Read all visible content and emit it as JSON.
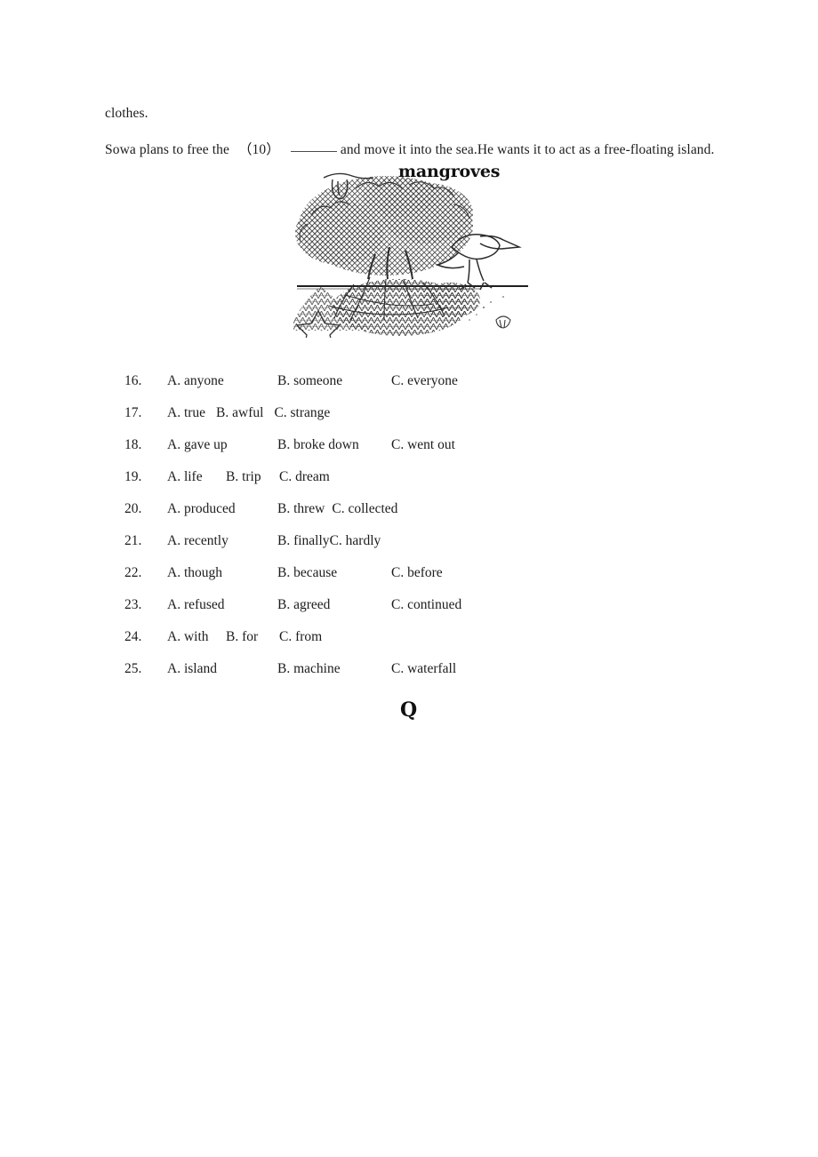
{
  "passage": {
    "line1": "clothes.",
    "line2_before": "Sowa plans to free the",
    "line2_paren": "（10）",
    "line2_after": "and move it into the sea.He wants it to act as a free-floating island."
  },
  "figure": {
    "caption": "mangroves",
    "alt_name": "mangroves-illustration"
  },
  "options": [
    {
      "number": "16.",
      "layout": "wide",
      "a": "A. anyone",
      "b": "B. someone",
      "c": "C. everyone"
    },
    {
      "number": "17.",
      "layout": "inline",
      "a": "A. true",
      "b": "B. awful",
      "c": "C. strange"
    },
    {
      "number": "18.",
      "layout": "wide",
      "a": "A. gave up",
      "b": "B. broke down",
      "c": "C. went out"
    },
    {
      "number": "19.",
      "layout": "abfix",
      "a": "A. life",
      "b": "B. trip",
      "c": "C. dream"
    },
    {
      "number": "20.",
      "layout": "mixed",
      "a": "A. produced",
      "b": "B. threw",
      "c": "C. collected"
    },
    {
      "number": "21.",
      "layout": "tight",
      "a": "A. recently",
      "b": "B. finally",
      "c": "C. hardly"
    },
    {
      "number": "22.",
      "layout": "wide",
      "a": "A. though",
      "b": "B. because",
      "c": "C. before"
    },
    {
      "number": "23.",
      "layout": "wide",
      "a": "A. refused",
      "b": "B. agreed",
      "c": "C. continued"
    },
    {
      "number": "24.",
      "layout": "abfix",
      "a": "A. with",
      "b": "B. for",
      "c": "C. from"
    },
    {
      "number": "25.",
      "layout": "wide",
      "a": "A. island",
      "b": "B. machine",
      "c": "C. waterfall"
    }
  ],
  "bottom_mark": "Q",
  "colors": {
    "page_background": "#ffffff",
    "text": "#1c1c1c",
    "ink": "#111111",
    "rule": "#4a4a4a"
  }
}
